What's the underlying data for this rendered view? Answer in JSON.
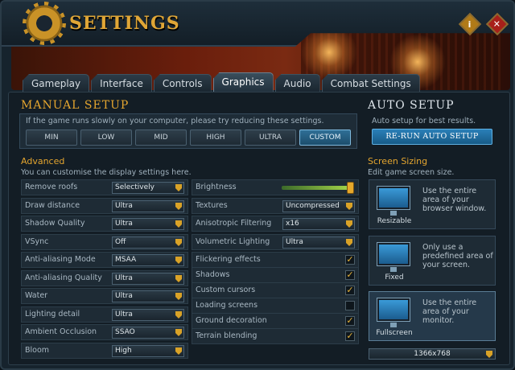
{
  "window": {
    "title": "Settings",
    "info_label": "i",
    "close_label": "✕"
  },
  "tabs": [
    {
      "label": "Gameplay"
    },
    {
      "label": "Interface"
    },
    {
      "label": "Controls"
    },
    {
      "label": "Graphics",
      "active": true
    },
    {
      "label": "Audio"
    },
    {
      "label": "Combat Settings"
    }
  ],
  "manual_setup": {
    "title": "Manual Setup",
    "hint": "If the game runs slowly on your computer, please try reducing these settings.",
    "presets": [
      "MIN",
      "LOW",
      "MID",
      "HIGH",
      "ULTRA",
      "CUSTOM"
    ],
    "selected_preset": "CUSTOM"
  },
  "auto_setup": {
    "title": "Auto Setup",
    "hint": "Auto setup for best results.",
    "button_label": "Re-run Auto Setup"
  },
  "advanced": {
    "title": "Advanced",
    "subtitle": "You can customise the display settings here.",
    "left_settings": [
      {
        "label": "Remove roofs",
        "value": "Selectively"
      },
      {
        "label": "Draw distance",
        "value": "Ultra"
      },
      {
        "label": "Shadow Quality",
        "value": "Ultra"
      },
      {
        "label": "VSync",
        "value": "Off"
      },
      {
        "label": "Anti-aliasing Mode",
        "value": "MSAA"
      },
      {
        "label": "Anti-aliasing Quality",
        "value": "Ultra"
      },
      {
        "label": "Water",
        "value": "Ultra"
      },
      {
        "label": "Lighting detail",
        "value": "Ultra"
      },
      {
        "label": "Ambient Occlusion",
        "value": "SSAO"
      },
      {
        "label": "Bloom",
        "value": "High"
      }
    ],
    "brightness": {
      "label": "Brightness",
      "level": 1.0
    },
    "right_dropdowns": [
      {
        "label": "Textures",
        "value": "Uncompressed"
      },
      {
        "label": "Anisotropic Filtering",
        "value": "x16"
      },
      {
        "label": "Volumetric Lighting",
        "value": "Ultra"
      }
    ],
    "right_checkboxes": [
      {
        "label": "Flickering effects",
        "checked": true
      },
      {
        "label": "Shadows",
        "checked": true
      },
      {
        "label": "Custom cursors",
        "checked": true
      },
      {
        "label": "Loading screens",
        "checked": false
      },
      {
        "label": "Ground decoration",
        "checked": true
      },
      {
        "label": "Terrain blending",
        "checked": true
      }
    ]
  },
  "screen_sizing": {
    "title": "Screen Sizing",
    "subtitle": "Edit game screen size.",
    "options": [
      {
        "caption": "Resizable",
        "desc": "Use the entire area of your browser window."
      },
      {
        "caption": "Fixed",
        "desc": "Only use a predefined area of your screen."
      },
      {
        "caption": "Fullscreen",
        "desc": "Use the entire area of your monitor.",
        "selected": true
      }
    ],
    "resolution": "1366x768"
  },
  "colors": {
    "accent": "#e4a52f",
    "selected_blue": "#2f6f96"
  },
  "icons": {
    "header": "gear-icon",
    "dropdown_arrow": "chevron-down-icon",
    "check": "checkmark-icon",
    "screen": "monitor-icon"
  }
}
